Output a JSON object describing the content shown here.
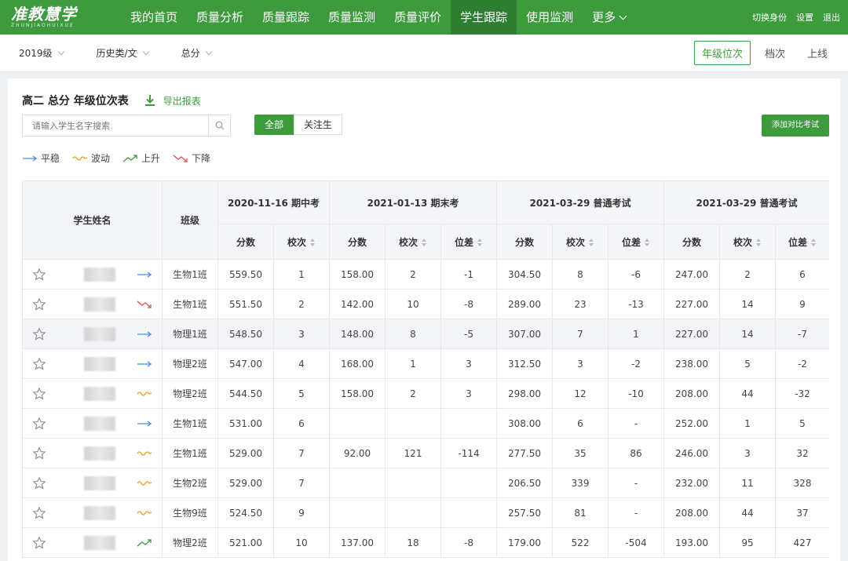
{
  "app": {
    "logo": "准教慧学",
    "logo_sub": "ZHUNJIAOHUIXUE"
  },
  "nav": {
    "items": [
      "我的首页",
      "质量分析",
      "质量跟踪",
      "质量监测",
      "质量评价",
      "学生跟踪",
      "使用监测"
    ],
    "active_index": 5,
    "more": "更多",
    "right": [
      "切换身份",
      "设置",
      "退出"
    ]
  },
  "filters": [
    "2019级",
    "历史类/文",
    "总分"
  ],
  "views": {
    "items": [
      "年级位次",
      "档次",
      "上线"
    ],
    "active_index": 0
  },
  "page_title": "高二 总分 年级位次表",
  "export_label": "导出报表",
  "search": {
    "placeholder": "请输入学生名字搜索"
  },
  "segments": {
    "items": [
      "全部",
      "关注生"
    ],
    "active_index": 0
  },
  "add_compare": "添加对比考试",
  "legend": [
    {
      "label": "平稳",
      "icon": "arrow-right-icon",
      "color": "#4a8fe2"
    },
    {
      "label": "波动",
      "icon": "wave-icon",
      "color": "#f0a020"
    },
    {
      "label": "上升",
      "icon": "trend-up-icon",
      "color": "#3d9a3d"
    },
    {
      "label": "下降",
      "icon": "trend-down-icon",
      "color": "#e05050"
    }
  ],
  "table": {
    "col_name": "学生姓名",
    "col_class": "班级",
    "exams": [
      "2020-11-16 期中考",
      "2021-01-13 期末考",
      "2021-03-29 普通考试",
      "2021-03-29 普通考试"
    ],
    "sub_score": "分数",
    "sub_rank": "校次",
    "sub_diff": "位差",
    "highlight_row": 2,
    "rows": [
      {
        "trend": "steady",
        "class": "生物1班",
        "v": [
          "559.50",
          "1",
          "158.00",
          "2",
          "-1",
          "304.50",
          "8",
          "-6",
          "247.00",
          "2",
          "6"
        ]
      },
      {
        "trend": "down",
        "class": "生物1班",
        "v": [
          "551.50",
          "2",
          "142.00",
          "10",
          "-8",
          "289.00",
          "23",
          "-13",
          "227.00",
          "14",
          "9"
        ]
      },
      {
        "trend": "steady",
        "class": "物理1班",
        "v": [
          "548.50",
          "3",
          "148.00",
          "8",
          "-5",
          "307.00",
          "7",
          "1",
          "227.00",
          "14",
          "-7"
        ]
      },
      {
        "trend": "steady",
        "class": "物理2班",
        "v": [
          "547.00",
          "4",
          "168.00",
          "1",
          "3",
          "312.50",
          "3",
          "-2",
          "238.00",
          "5",
          "-2"
        ]
      },
      {
        "trend": "wave",
        "class": "物理2班",
        "v": [
          "544.50",
          "5",
          "158.00",
          "2",
          "3",
          "298.00",
          "12",
          "-10",
          "208.00",
          "44",
          "-32"
        ]
      },
      {
        "trend": "steady",
        "class": "生物1班",
        "v": [
          "531.00",
          "6",
          "",
          "",
          "",
          "308.00",
          "6",
          "-",
          "252.00",
          "1",
          "5"
        ]
      },
      {
        "trend": "wave",
        "class": "生物1班",
        "v": [
          "529.00",
          "7",
          "92.00",
          "121",
          "-114",
          "277.50",
          "35",
          "86",
          "246.00",
          "3",
          "32"
        ]
      },
      {
        "trend": "wave",
        "class": "生物2班",
        "v": [
          "529.00",
          "7",
          "",
          "",
          "",
          "206.50",
          "339",
          "-",
          "232.00",
          "11",
          "328"
        ]
      },
      {
        "trend": "wave",
        "class": "生物9班",
        "v": [
          "524.50",
          "9",
          "",
          "",
          "",
          "257.50",
          "81",
          "-",
          "208.00",
          "44",
          "37"
        ]
      },
      {
        "trend": "up",
        "class": "物理2班",
        "v": [
          "521.00",
          "10",
          "137.00",
          "18",
          "-8",
          "179.00",
          "522",
          "-504",
          "193.00",
          "95",
          "427"
        ]
      }
    ]
  }
}
